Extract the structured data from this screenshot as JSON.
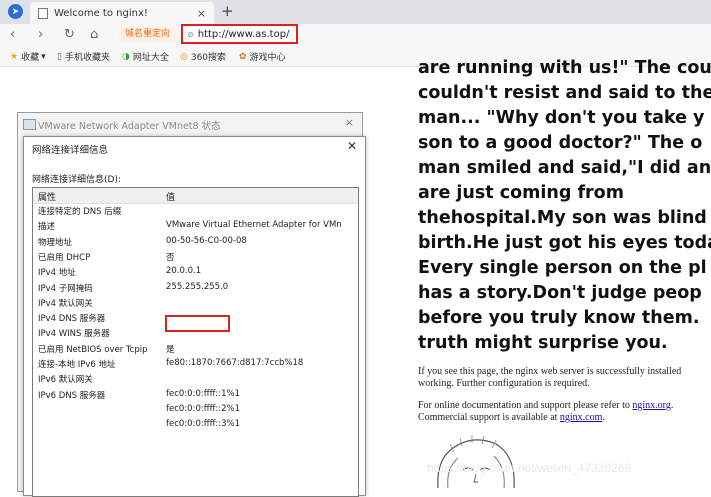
{
  "browser": {
    "tab_title": "Welcome to nginx!",
    "tab_close": "×",
    "new_tab": "+",
    "nav": {
      "back": "‹",
      "forward": "›",
      "reload": "↻",
      "home": "⌂"
    },
    "redirect_badge": "城名重定向",
    "url": "http://www.as.top/",
    "url_icon": "⊘",
    "bookmarks": [
      {
        "icon": "★",
        "label": "收藏",
        "suffix": "▾"
      },
      {
        "icon": "▯",
        "label": "手机收藏夹"
      },
      {
        "icon": "◑",
        "label": "网址大全"
      },
      {
        "icon": "◎",
        "label": "360搜索"
      },
      {
        "icon": "✿",
        "label": "游戏中心"
      }
    ],
    "accent_color": "#e02020"
  },
  "story_lines": [
    "are running with us!\" The cou",
    "couldn't resist and said to the",
    "man... \"Why don't you take y",
    "son to a good doctor?\" The o",
    "man smiled and said,\"I did an",
    "are just coming from",
    "thehospital.My son was blind",
    "birth.He just got his eyes toda",
    "Every single person on the pl",
    "has a story.Don't judge peop",
    "before you truly know them.",
    "truth might surprise you."
  ],
  "nginx": {
    "line1": "If you see this page, the nginx web server is successfully installed",
    "line2": "working. Further configuration is required.",
    "line3_pre": "For online documentation and support please refer to ",
    "link1": "nginx.org",
    "line3_post": ".",
    "line4_pre": "Commercial support is available at ",
    "link2": "nginx.com",
    "line4_post": "."
  },
  "watermark": "https://blog.csdn.net/weixin_47320266",
  "vm_window": {
    "title": "VMware Network Adapter VMnet8 状态",
    "close": "×"
  },
  "details_dialog": {
    "title": "网络连接详细信息",
    "close": "✕",
    "sublabel": "网络连接详细信息(D):",
    "col_property": "属性",
    "col_value": "值",
    "rows": [
      {
        "k": "连接特定的 DNS 后缀",
        "v": ""
      },
      {
        "k": "描述",
        "v": "VMware Virtual Ethernet Adapter for VMn"
      },
      {
        "k": "物理地址",
        "v": "00-50-56-C0-00-08"
      },
      {
        "k": "已启用 DHCP",
        "v": "否"
      },
      {
        "k": "IPv4 地址",
        "v": "20.0.0.1"
      },
      {
        "k": "IPv4 子网掩码",
        "v": "255.255.255.0"
      },
      {
        "k": "IPv4 默认网关",
        "v": ""
      },
      {
        "k": "IPv4 DNS 服务器",
        "v": ""
      },
      {
        "k": "IPv4 WINS 服务器",
        "v": ""
      },
      {
        "k": "已启用 NetBIOS over Tcpip",
        "v": "是"
      },
      {
        "k": "连接-本地 IPv6 地址",
        "v": "fe80::1870:7667:d817:7ccb%18"
      },
      {
        "k": "IPv6 默认网关",
        "v": ""
      },
      {
        "k": "IPv6 DNS 服务器",
        "v": "fec0:0:0:ffff::1%1"
      },
      {
        "k": "",
        "v": "fec0:0:0:ffff::2%1"
      },
      {
        "k": "",
        "v": "fec0:0:0:ffff::3%1"
      }
    ]
  }
}
